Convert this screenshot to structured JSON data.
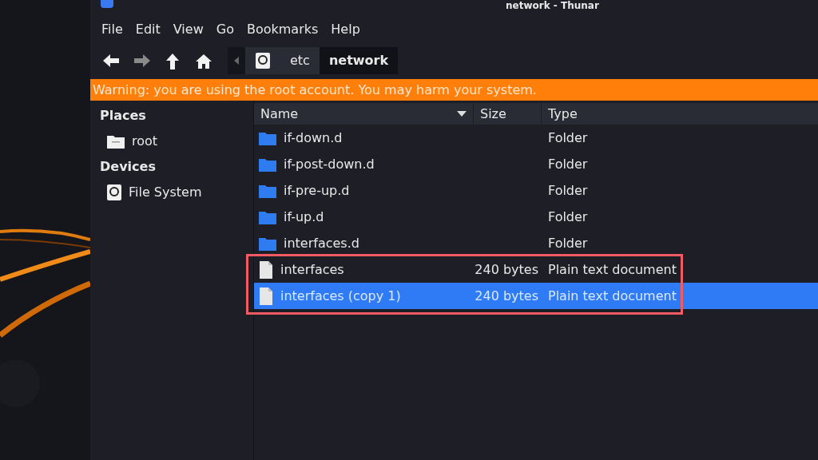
{
  "window": {
    "title": "network - Thunar"
  },
  "menu": [
    "File",
    "Edit",
    "View",
    "Go",
    "Bookmarks",
    "Help"
  ],
  "toolbar": {
    "nav": [
      {
        "kind": "back",
        "disabled": false
      },
      {
        "kind": "forward",
        "disabled": true
      },
      {
        "kind": "up",
        "disabled": false
      },
      {
        "kind": "home",
        "disabled": false
      }
    ],
    "path": [
      {
        "kind": "drive",
        "selected": false
      },
      {
        "label": "etc",
        "selected": false
      },
      {
        "label": "network",
        "selected": true
      }
    ]
  },
  "warning": "Warning: you are using the root account. You may harm your system.",
  "sidebar": [
    {
      "heading": "Places",
      "items": [
        {
          "kind": "folder",
          "label": "root"
        }
      ]
    },
    {
      "heading": "Devices",
      "items": [
        {
          "kind": "drive",
          "label": "File System"
        }
      ]
    }
  ],
  "table": {
    "columns": [
      "Name",
      "Size",
      "Type"
    ],
    "rows": [
      {
        "kind": "folder",
        "name": "if-down.d",
        "size": "",
        "type": "Folder",
        "selected": false
      },
      {
        "kind": "folder",
        "name": "if-post-down.d",
        "size": "",
        "type": "Folder",
        "selected": false
      },
      {
        "kind": "folder",
        "name": "if-pre-up.d",
        "size": "",
        "type": "Folder",
        "selected": false
      },
      {
        "kind": "folder",
        "name": "if-up.d",
        "size": "",
        "type": "Folder",
        "selected": false
      },
      {
        "kind": "folder",
        "name": "interfaces.d",
        "size": "",
        "type": "Folder",
        "selected": false
      },
      {
        "kind": "file",
        "name": "interfaces",
        "size": "240 bytes",
        "type": "Plain text document",
        "selected": false
      },
      {
        "kind": "file",
        "name": "interfaces (copy 1)",
        "size": "240 bytes",
        "type": "Plain text document",
        "selected": true
      }
    ]
  }
}
